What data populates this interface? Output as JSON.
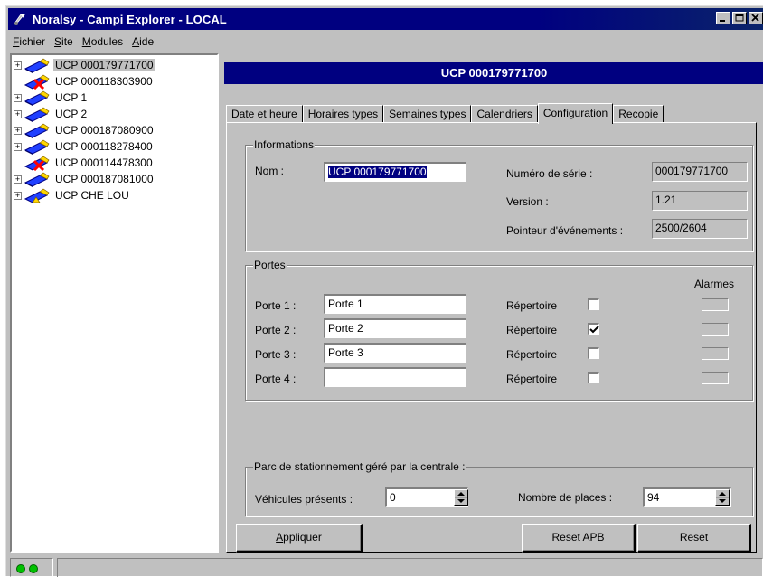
{
  "window": {
    "title": "Noralsy - Campi Explorer - LOCAL",
    "buttons": {
      "minimize": "_",
      "maximize": "□",
      "close": "x"
    }
  },
  "menu": [
    {
      "text": "Fichier",
      "mnemonic_index": 0
    },
    {
      "text": "Site",
      "mnemonic_index": 0
    },
    {
      "text": "Modules",
      "mnemonic_index": 0
    },
    {
      "text": "Aide",
      "mnemonic_index": 0
    }
  ],
  "tree": {
    "items": [
      {
        "label": "UCP 000179771700",
        "expandable": true,
        "status": "online",
        "selected": true
      },
      {
        "label": "UCP 000118303900",
        "expandable": false,
        "status": "error",
        "selected": false
      },
      {
        "label": "UCP 1",
        "expandable": true,
        "status": "online",
        "selected": false
      },
      {
        "label": "UCP 2",
        "expandable": true,
        "status": "online",
        "selected": false
      },
      {
        "label": "UCP 000187080900",
        "expandable": true,
        "status": "online",
        "selected": false
      },
      {
        "label": "UCP 000118278400",
        "expandable": true,
        "status": "online",
        "selected": false
      },
      {
        "label": "UCP 000114478300",
        "expandable": false,
        "status": "error",
        "selected": false
      },
      {
        "label": "UCP 000187081000",
        "expandable": true,
        "status": "online",
        "selected": false
      },
      {
        "label": "UCP CHE LOU",
        "expandable": true,
        "status": "warning",
        "selected": false
      }
    ]
  },
  "header": {
    "title": "UCP 000179771700"
  },
  "tabs": [
    {
      "label": "Date et heure",
      "active": false
    },
    {
      "label": "Horaires types",
      "active": false
    },
    {
      "label": "Semaines types",
      "active": false
    },
    {
      "label": "Calendriers",
      "active": false
    },
    {
      "label": "Configuration",
      "active": true
    },
    {
      "label": "Recopie",
      "active": false
    }
  ],
  "informations": {
    "group_title": "Informations",
    "nom_label": "Nom :",
    "nom_value": "UCP 000179771700",
    "serie_label": "Numéro de série :",
    "serie_value": "000179771700",
    "version_label": "Version :",
    "version_value": "1.21",
    "pointeur_label": "Pointeur d'événements :",
    "pointeur_value": "2500/2604"
  },
  "portes": {
    "group_title": "Portes",
    "alarmes_label": "Alarmes",
    "repertoire_label": "Répertoire",
    "rows": [
      {
        "label": "Porte 1 :",
        "value": "Porte 1",
        "repertoire": false
      },
      {
        "label": "Porte 2 :",
        "value": "Porte 2",
        "repertoire": true
      },
      {
        "label": "Porte 3 :",
        "value": "Porte 3",
        "repertoire": false
      },
      {
        "label": "Porte 4 :",
        "value": "",
        "repertoire": false
      }
    ]
  },
  "parking": {
    "group_title": "Parc de stationnement géré par la centrale :",
    "vehicules_label": "Véhicules présents :",
    "vehicules_value": "0",
    "places_label": "Nombre de places :",
    "places_value": "94"
  },
  "buttons": {
    "appliquer": "Appliquer",
    "reset_apb": "Reset APB",
    "reset": "Reset"
  },
  "colors": {
    "titlebar": "#000080",
    "face": "#c0c0c0",
    "led": "#00c000"
  }
}
